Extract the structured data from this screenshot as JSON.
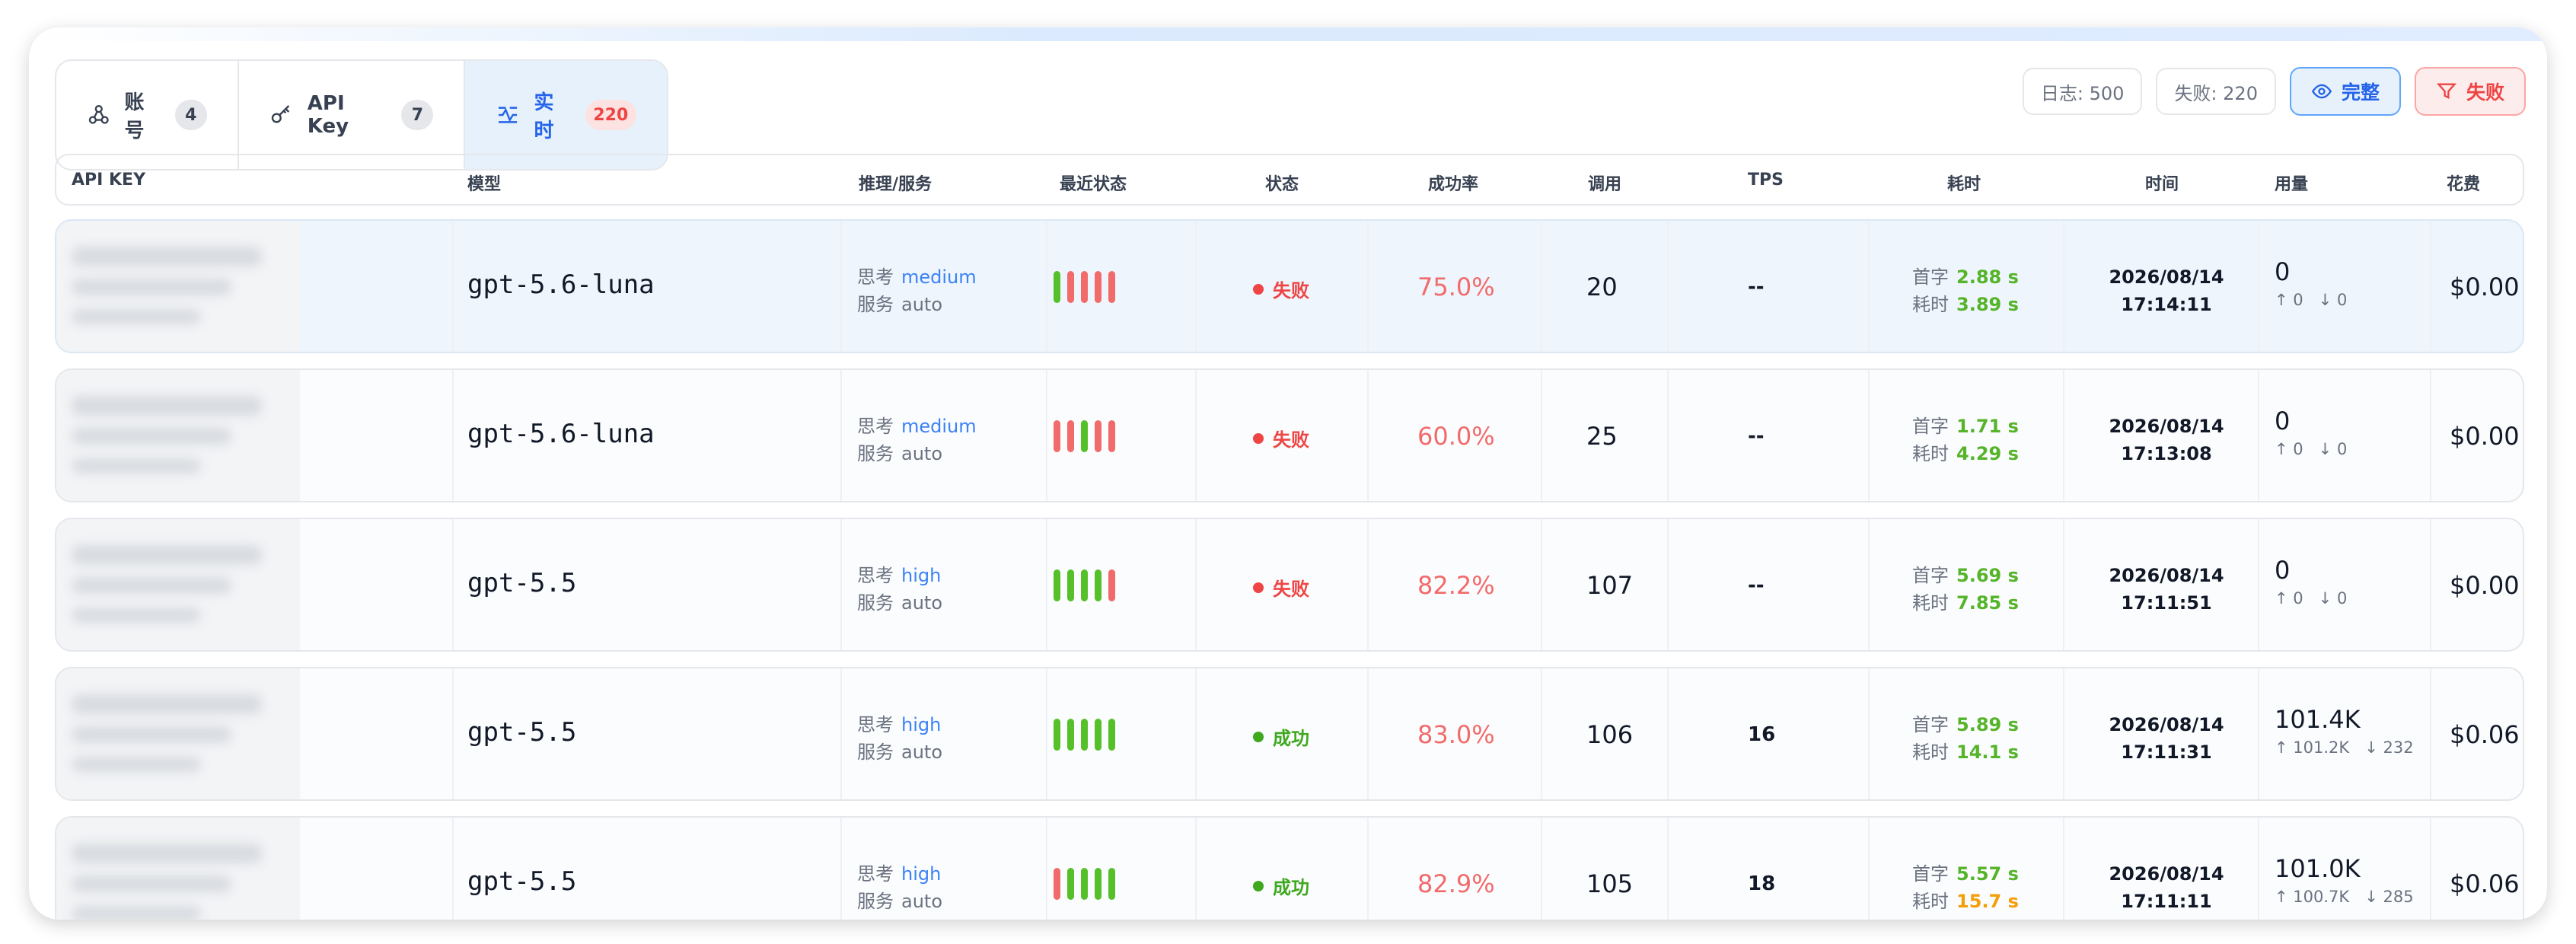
{
  "tabs": [
    {
      "label": "账号",
      "count": "4",
      "icon": "share-nodes-icon"
    },
    {
      "label": "API Key",
      "count": "7",
      "icon": "key-icon"
    },
    {
      "label": "实时",
      "count": "220",
      "icon": "activity-icon"
    }
  ],
  "toolbar": {
    "logs_chip": "日志: 500",
    "fails_chip": "失败: 220",
    "complete_button": "完整",
    "fail_filter_button": "失败"
  },
  "columns": [
    "API KEY",
    "模型",
    "推理/服务",
    "最近状态",
    "状态",
    "成功率",
    "调用",
    "TPS",
    "耗时",
    "时间",
    "用量",
    "花费"
  ],
  "labels": {
    "think": "思考",
    "service": "服务",
    "first_token": "首字",
    "duration": "耗时"
  },
  "rows": [
    {
      "model": "gpt-5.6-luna",
      "think": "medium",
      "service": "auto",
      "recent": [
        "ok",
        "bad",
        "bad",
        "bad",
        "bad"
      ],
      "status": "失败",
      "status_type": "fail",
      "rate": "75.0%",
      "calls": "20",
      "tps": "--",
      "first": "2.88 s",
      "total": "3.89 s",
      "date": "2026/08/14",
      "clock": "17:14:11",
      "usage": "0",
      "up": "↑ 0",
      "down": "↓ 0",
      "cost": "$0.00"
    },
    {
      "model": "gpt-5.6-luna",
      "think": "medium",
      "service": "auto",
      "recent": [
        "bad",
        "bad",
        "ok",
        "bad",
        "bad"
      ],
      "status": "失败",
      "status_type": "fail",
      "rate": "60.0%",
      "calls": "25",
      "tps": "--",
      "first": "1.71 s",
      "total": "4.29 s",
      "date": "2026/08/14",
      "clock": "17:13:08",
      "usage": "0",
      "up": "↑ 0",
      "down": "↓ 0",
      "cost": "$0.00"
    },
    {
      "model": "gpt-5.5",
      "think": "high",
      "service": "auto",
      "recent": [
        "ok",
        "ok",
        "ok",
        "ok",
        "bad"
      ],
      "status": "失败",
      "status_type": "fail",
      "rate": "82.2%",
      "calls": "107",
      "tps": "--",
      "first": "5.69 s",
      "total": "7.85 s",
      "date": "2026/08/14",
      "clock": "17:11:51",
      "usage": "0",
      "up": "↑ 0",
      "down": "↓ 0",
      "cost": "$0.00"
    },
    {
      "model": "gpt-5.5",
      "think": "high",
      "service": "auto",
      "recent": [
        "ok",
        "ok",
        "ok",
        "ok",
        "ok"
      ],
      "status": "成功",
      "status_type": "succ",
      "rate": "83.0%",
      "calls": "106",
      "tps": "16",
      "first": "5.89 s",
      "total": "14.1 s",
      "date": "2026/08/14",
      "clock": "17:11:31",
      "usage": "101.4K",
      "up": "↑ 101.2K",
      "down": "↓ 232",
      "cost": "$0.06"
    },
    {
      "model": "gpt-5.5",
      "think": "high",
      "service": "auto",
      "recent": [
        "bad",
        "ok",
        "ok",
        "ok",
        "ok"
      ],
      "status": "成功",
      "status_type": "succ",
      "rate": "82.9%",
      "calls": "105",
      "tps": "18",
      "first": "5.57 s",
      "total": "15.7 s",
      "total_warn": true,
      "date": "2026/08/14",
      "clock": "17:11:11",
      "usage": "101.0K",
      "up": "↑ 100.7K",
      "down": "↓ 285",
      "cost": "$0.06"
    }
  ]
}
